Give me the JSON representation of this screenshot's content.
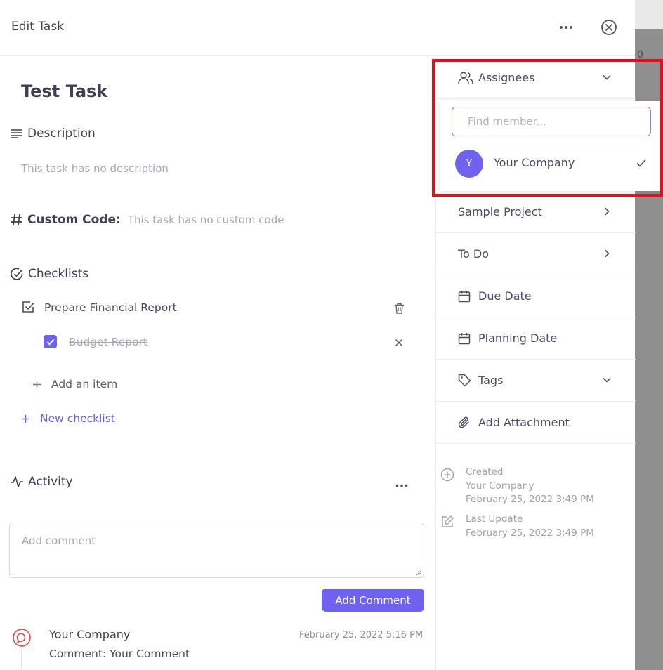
{
  "header": {
    "title": "Edit Task"
  },
  "task": {
    "title": "Test Task"
  },
  "description": {
    "heading": "Description",
    "empty_text": "This task has no description"
  },
  "custom_code": {
    "label": "Custom Code:",
    "empty_text": "This task has no custom code"
  },
  "checklists": {
    "heading": "Checklists",
    "groups": [
      {
        "title": "Prepare Financial Report",
        "items": [
          {
            "label": "Budget Report",
            "checked": true
          }
        ]
      }
    ],
    "add_item_label": "Add an item",
    "new_checklist_label": "New checklist"
  },
  "activity": {
    "heading": "Activity",
    "comment_placeholder": "Add comment",
    "add_comment_label": "Add Comment",
    "comments": [
      {
        "author": "Your Company",
        "time": "February 25, 2022 5:16 PM",
        "text": "Comment: Your Comment"
      }
    ]
  },
  "sidebar": {
    "assignees_label": "Assignees",
    "project_label": "Sample Project",
    "status_label": "To Do",
    "due_date_label": "Due Date",
    "planning_date_label": "Planning Date",
    "tags_label": "Tags",
    "attachment_label": "Add Attachment",
    "created": {
      "label": "Created",
      "by": "Your Company",
      "date": "February 25, 2022 3:49 PM"
    },
    "updated": {
      "label": "Last Update",
      "date": "February 25, 2022 3:49 PM"
    }
  },
  "assignee_dropdown": {
    "search_placeholder": "Find member...",
    "members": [
      {
        "initial": "Y",
        "name": "Your Company",
        "selected": true
      }
    ]
  },
  "colors": {
    "accent": "#6f62ee",
    "highlight": "#e01020",
    "muted_text": "#a6a6b5"
  }
}
